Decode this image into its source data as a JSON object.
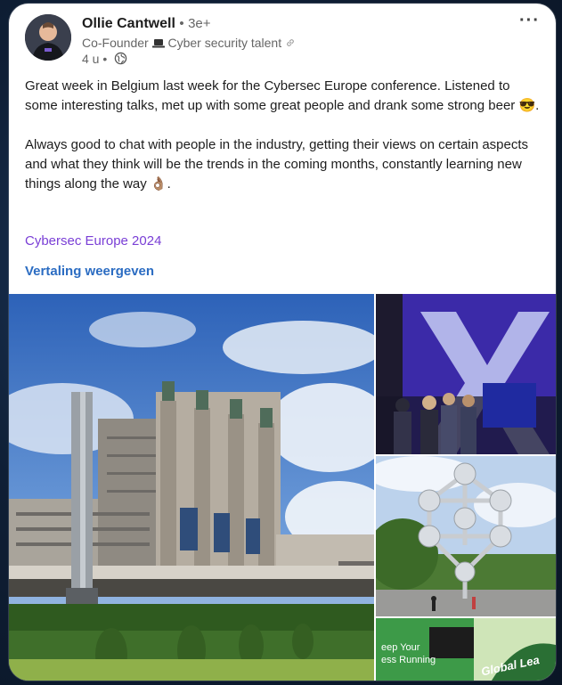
{
  "post": {
    "author": {
      "name": "Ollie Cantwell",
      "separator": "•",
      "degree": "3e+",
      "headline_prefix": "Co-Founder",
      "headline_suffix": "Cyber security talent",
      "time": "4 u",
      "dot": "•",
      "visibility_icon": "globe-icon"
    },
    "more_label": "···",
    "text_paragraph_1": "Great week in Belgium last week for the Cybersec Europe conference. Listened to some interesting talks, met up with some great people and drank some strong beer 😎.",
    "text_paragraph_2": "Always good to chat with people in the industry, getting their views on certain aspects and what they think will be the trends in the coming months, constantly learning new things along the way 👌🏽.",
    "hashtag": "Cybersec Europe 2024",
    "translate_label": "Vertaling weergeven",
    "photos": [
      {
        "subject": "Brussels Expo Palace 5 building with hedges under blue sky"
      },
      {
        "subject": "Conference stage with large purple X screen and attendees"
      },
      {
        "subject": "Atomium monument with street and trees"
      },
      {
        "subject": "Green exhibition booth banner"
      }
    ],
    "photo_texts": {
      "booth_left": "eep Your",
      "booth_left2": "ess Running",
      "booth_right": "Global Lea"
    }
  },
  "colors": {
    "accent_link": "#2b6cc2",
    "hashtag": "#7a3fd6",
    "background": "#0f1f36",
    "card": "#ffffff"
  }
}
